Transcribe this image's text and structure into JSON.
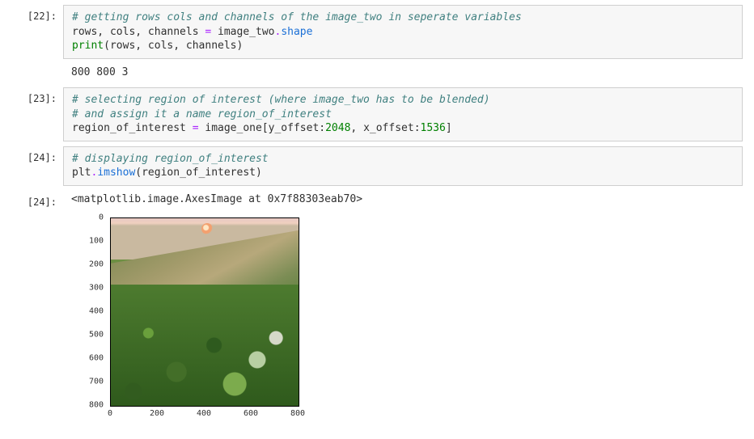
{
  "cells": {
    "c22": {
      "prompt": "[22]:",
      "line1_comment": "# getting rows cols and channels of the image_two in seperate variables",
      "line2_lhs": "rows, cols, channels ",
      "line2_eq": "= ",
      "line2_obj": "image_two",
      "line2_dot": ".",
      "line2_attr": "shape",
      "line3_print": "print",
      "line3_args": "(rows, cols, channels)",
      "output": "800 800 3"
    },
    "c23": {
      "prompt": "[23]:",
      "line1_comment": "# selecting region of interest (where image_two has to be blended)",
      "line2_comment": "# and assign it a name region_of_interest",
      "line3_lhs": "region_of_interest ",
      "line3_eq": "= ",
      "line3_obj": "image_one",
      "line3_br1": "[",
      "line3_a1": "y_offset",
      "line3_colon1": ":",
      "line3_n1": "2048",
      "line3_comma": ", ",
      "line3_a2": "x_offset",
      "line3_colon2": ":",
      "line3_n2": "1536",
      "line3_br2": "]"
    },
    "c24a": {
      "prompt": "[24]:",
      "line1_comment": "# displaying region_of_interest",
      "line2_obj": "plt",
      "line2_dot": ".",
      "line2_call": "imshow",
      "line2_args": "(region_of_interest)"
    },
    "c24b": {
      "prompt": "[24]:",
      "repr": "<matplotlib.image.AxesImage at 0x7f88303eab70>"
    }
  },
  "chart_data": {
    "type": "heatmap",
    "title": "",
    "xlabel": "",
    "ylabel": "",
    "xlim": [
      0,
      800
    ],
    "ylim": [
      800,
      0
    ],
    "x_ticks": [
      0,
      200,
      400,
      600,
      800
    ],
    "y_ticks": [
      0,
      100,
      200,
      300,
      400,
      500,
      600,
      700,
      800
    ],
    "image_description": "ROI from image_one showing a grassy hillside with a dirt escarpment under a pale sunset sky with a small sun near the top center."
  }
}
